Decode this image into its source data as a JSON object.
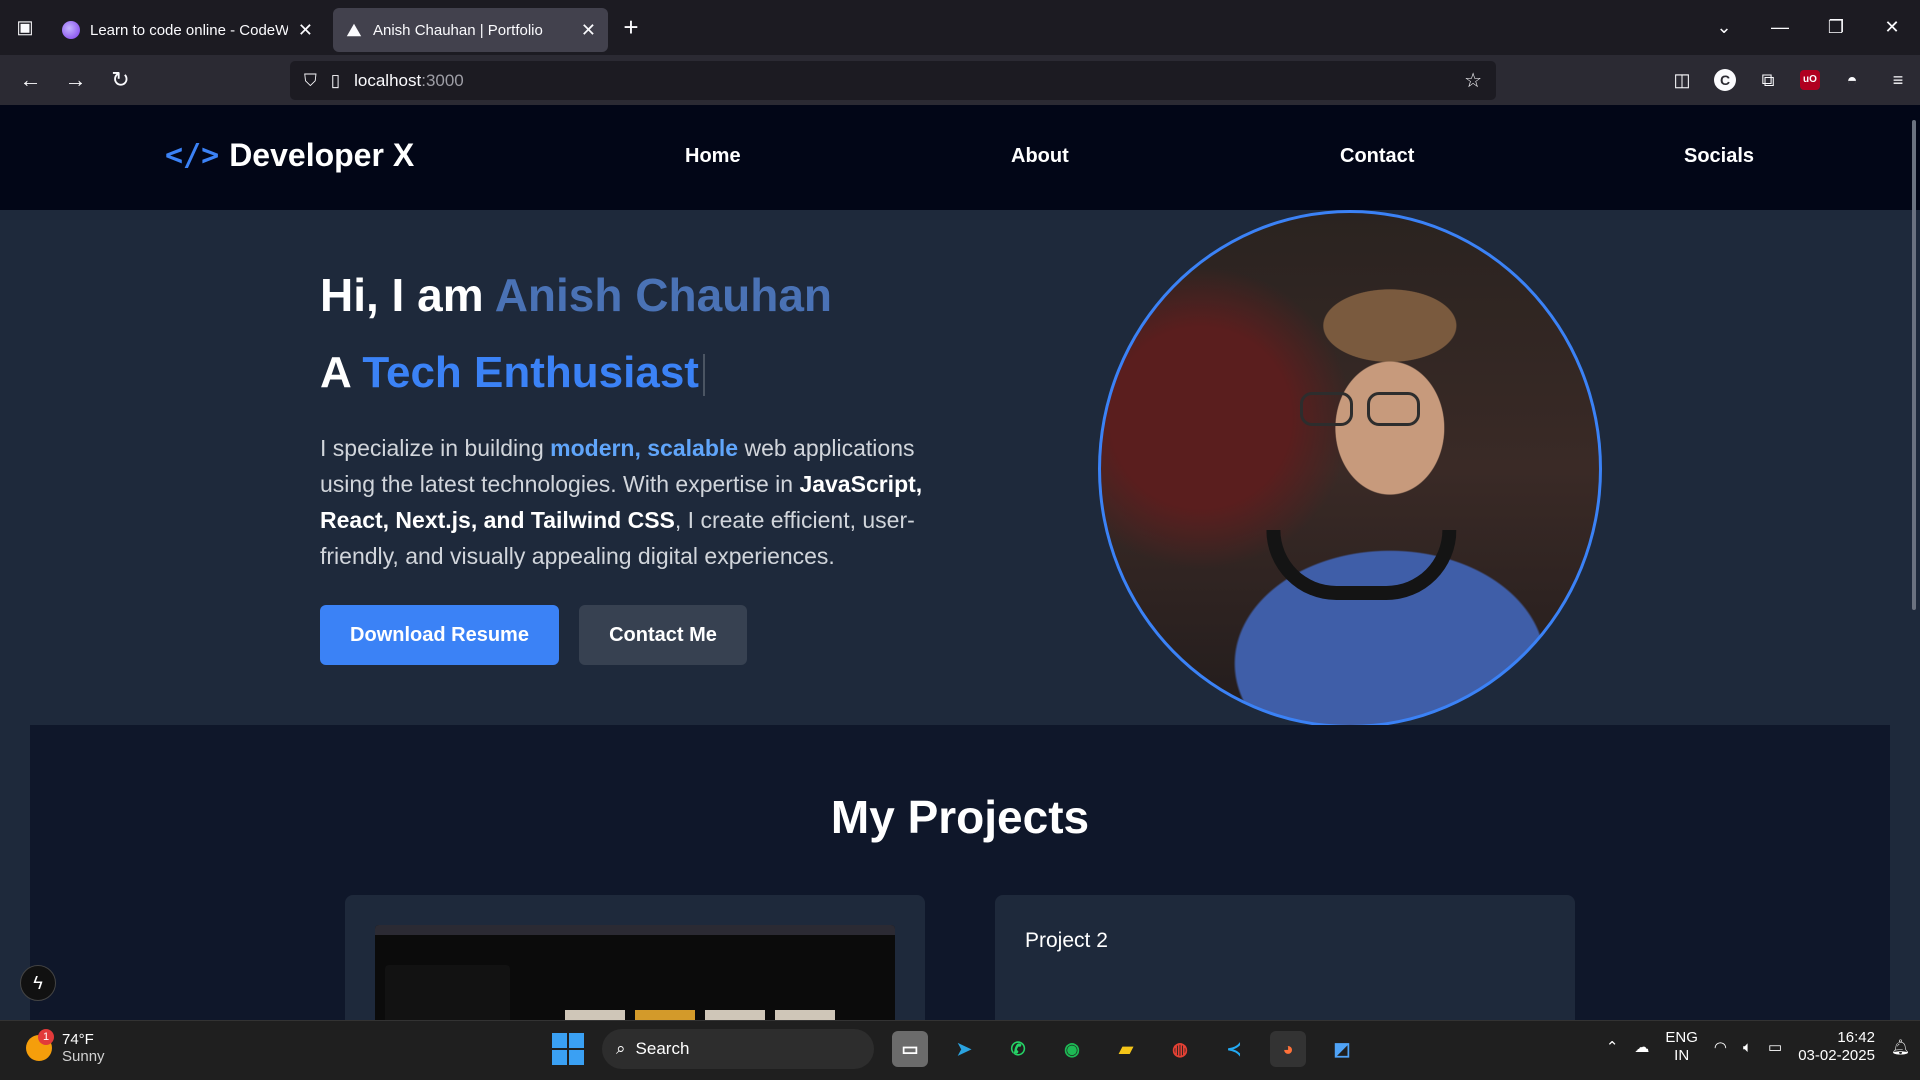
{
  "browser": {
    "tabs": [
      {
        "title": "Learn to code online - CodeWit",
        "active": false
      },
      {
        "title": "Anish Chauhan | Portfolio",
        "active": true
      }
    ],
    "url_host": "localhost",
    "url_port": ":3000"
  },
  "site": {
    "logo_code": "</>",
    "logo_text": "Developer X",
    "menu": [
      "Home",
      "About",
      "Contact",
      "Socials"
    ]
  },
  "hero": {
    "greeting": "Hi, I am ",
    "name": "Anish Chauhan",
    "article": "A ",
    "role": "Tech Enthusiast",
    "intro_1": "I specialize in building ",
    "intro_hl": "modern, scalable",
    "intro_2": " web applications using the latest technologies. With expertise in ",
    "intro_bold": "JavaScript, React, Next.js, and Tailwind CSS",
    "intro_3": ", I create efficient, user-friendly, and visually appealing digital experiences.",
    "download_label": "Download Resume",
    "contact_label": "Contact Me"
  },
  "projects": {
    "heading": "My Projects",
    "items": [
      {
        "title": ""
      },
      {
        "title": "Project 2"
      }
    ]
  },
  "taskbar": {
    "weather_temp": "74°F",
    "weather_desc": "Sunny",
    "weather_badge": "1",
    "search_placeholder": "Search",
    "lang_1": "ENG",
    "lang_2": "IN",
    "time": "16:42",
    "date": "03-02-2025"
  },
  "colors": {
    "accent": "#3b82f6",
    "name_color": "#4a72b5",
    "header_bg": "#020617",
    "page_bg": "#1e293b"
  }
}
